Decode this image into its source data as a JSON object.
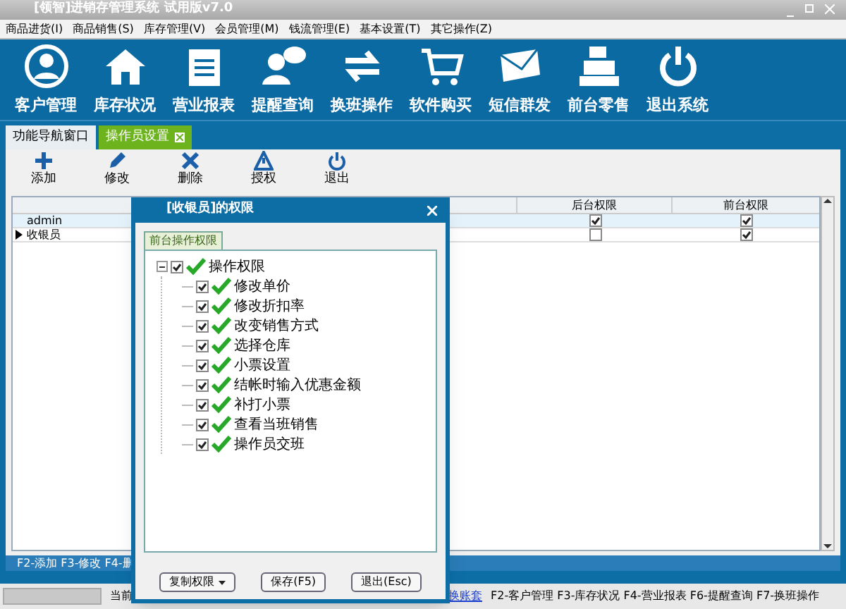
{
  "window": {
    "title": "[领智]进销存管理系统 试用版v7.0"
  },
  "menu": [
    "商品进货(I)",
    "商品销售(S)",
    "库存管理(V)",
    "会员管理(M)",
    "钱流管理(E)",
    "基本设置(T)",
    "其它操作(Z)"
  ],
  "nav": [
    {
      "kind": "user",
      "label": "客户管理"
    },
    {
      "kind": "house",
      "label": "库存状况"
    },
    {
      "kind": "notepad",
      "label": "营业报表"
    },
    {
      "kind": "chat",
      "label": "提醒查询"
    },
    {
      "kind": "swap",
      "label": "换班操作"
    },
    {
      "kind": "cart",
      "label": "软件购买"
    },
    {
      "kind": "mail",
      "label": "短信群发"
    },
    {
      "kind": "register",
      "label": "前台零售"
    },
    {
      "kind": "power",
      "label": "退出系统"
    }
  ],
  "tabs": [
    {
      "label": "功能导航窗口",
      "selected": false,
      "closable": false
    },
    {
      "label": "操作员设置",
      "selected": true,
      "closable": true
    }
  ],
  "toolbar": [
    {
      "kind": "plus",
      "label": "添加"
    },
    {
      "kind": "pencil",
      "label": "修改"
    },
    {
      "kind": "x",
      "label": "删除"
    },
    {
      "kind": "warn",
      "label": "授权"
    },
    {
      "kind": "power",
      "label": "退出"
    }
  ],
  "table": {
    "columns": [
      "后台权限",
      "前台权限"
    ],
    "rows": [
      {
        "name": "admin",
        "selected": false,
        "back": true,
        "front": true
      },
      {
        "name": "收银员",
        "selected": true,
        "back": false,
        "front": true
      }
    ]
  },
  "hotkeys": "F2-添加 F3-修改 F4-删",
  "status": {
    "current": "当前",
    "link": "换账套",
    "hotkeys": "F2-客户管理 F3-库存状况 F4-营业报表 F6-提醒查询 F7-换班操作"
  },
  "dialog": {
    "title": "[收银员]的权限",
    "tab": "前台操作权限",
    "tree": {
      "label": "操作权限",
      "checked": true,
      "expanded": true,
      "children": [
        {
          "label": "修改单价",
          "checked": true
        },
        {
          "label": "修改折扣率",
          "checked": true
        },
        {
          "label": "改变销售方式",
          "checked": true
        },
        {
          "label": "选择仓库",
          "checked": true
        },
        {
          "label": "小票设置",
          "checked": true
        },
        {
          "label": "结帐时输入优惠金额",
          "checked": true
        },
        {
          "label": "补打小票",
          "checked": true
        },
        {
          "label": "查看当班销售",
          "checked": true
        },
        {
          "label": "操作员交班",
          "checked": true
        }
      ]
    },
    "buttons": [
      {
        "label": "复制权限",
        "dropdown": true
      },
      {
        "label": "保存(F5)",
        "dropdown": false
      },
      {
        "label": "退出(Esc)",
        "dropdown": false
      }
    ]
  }
}
